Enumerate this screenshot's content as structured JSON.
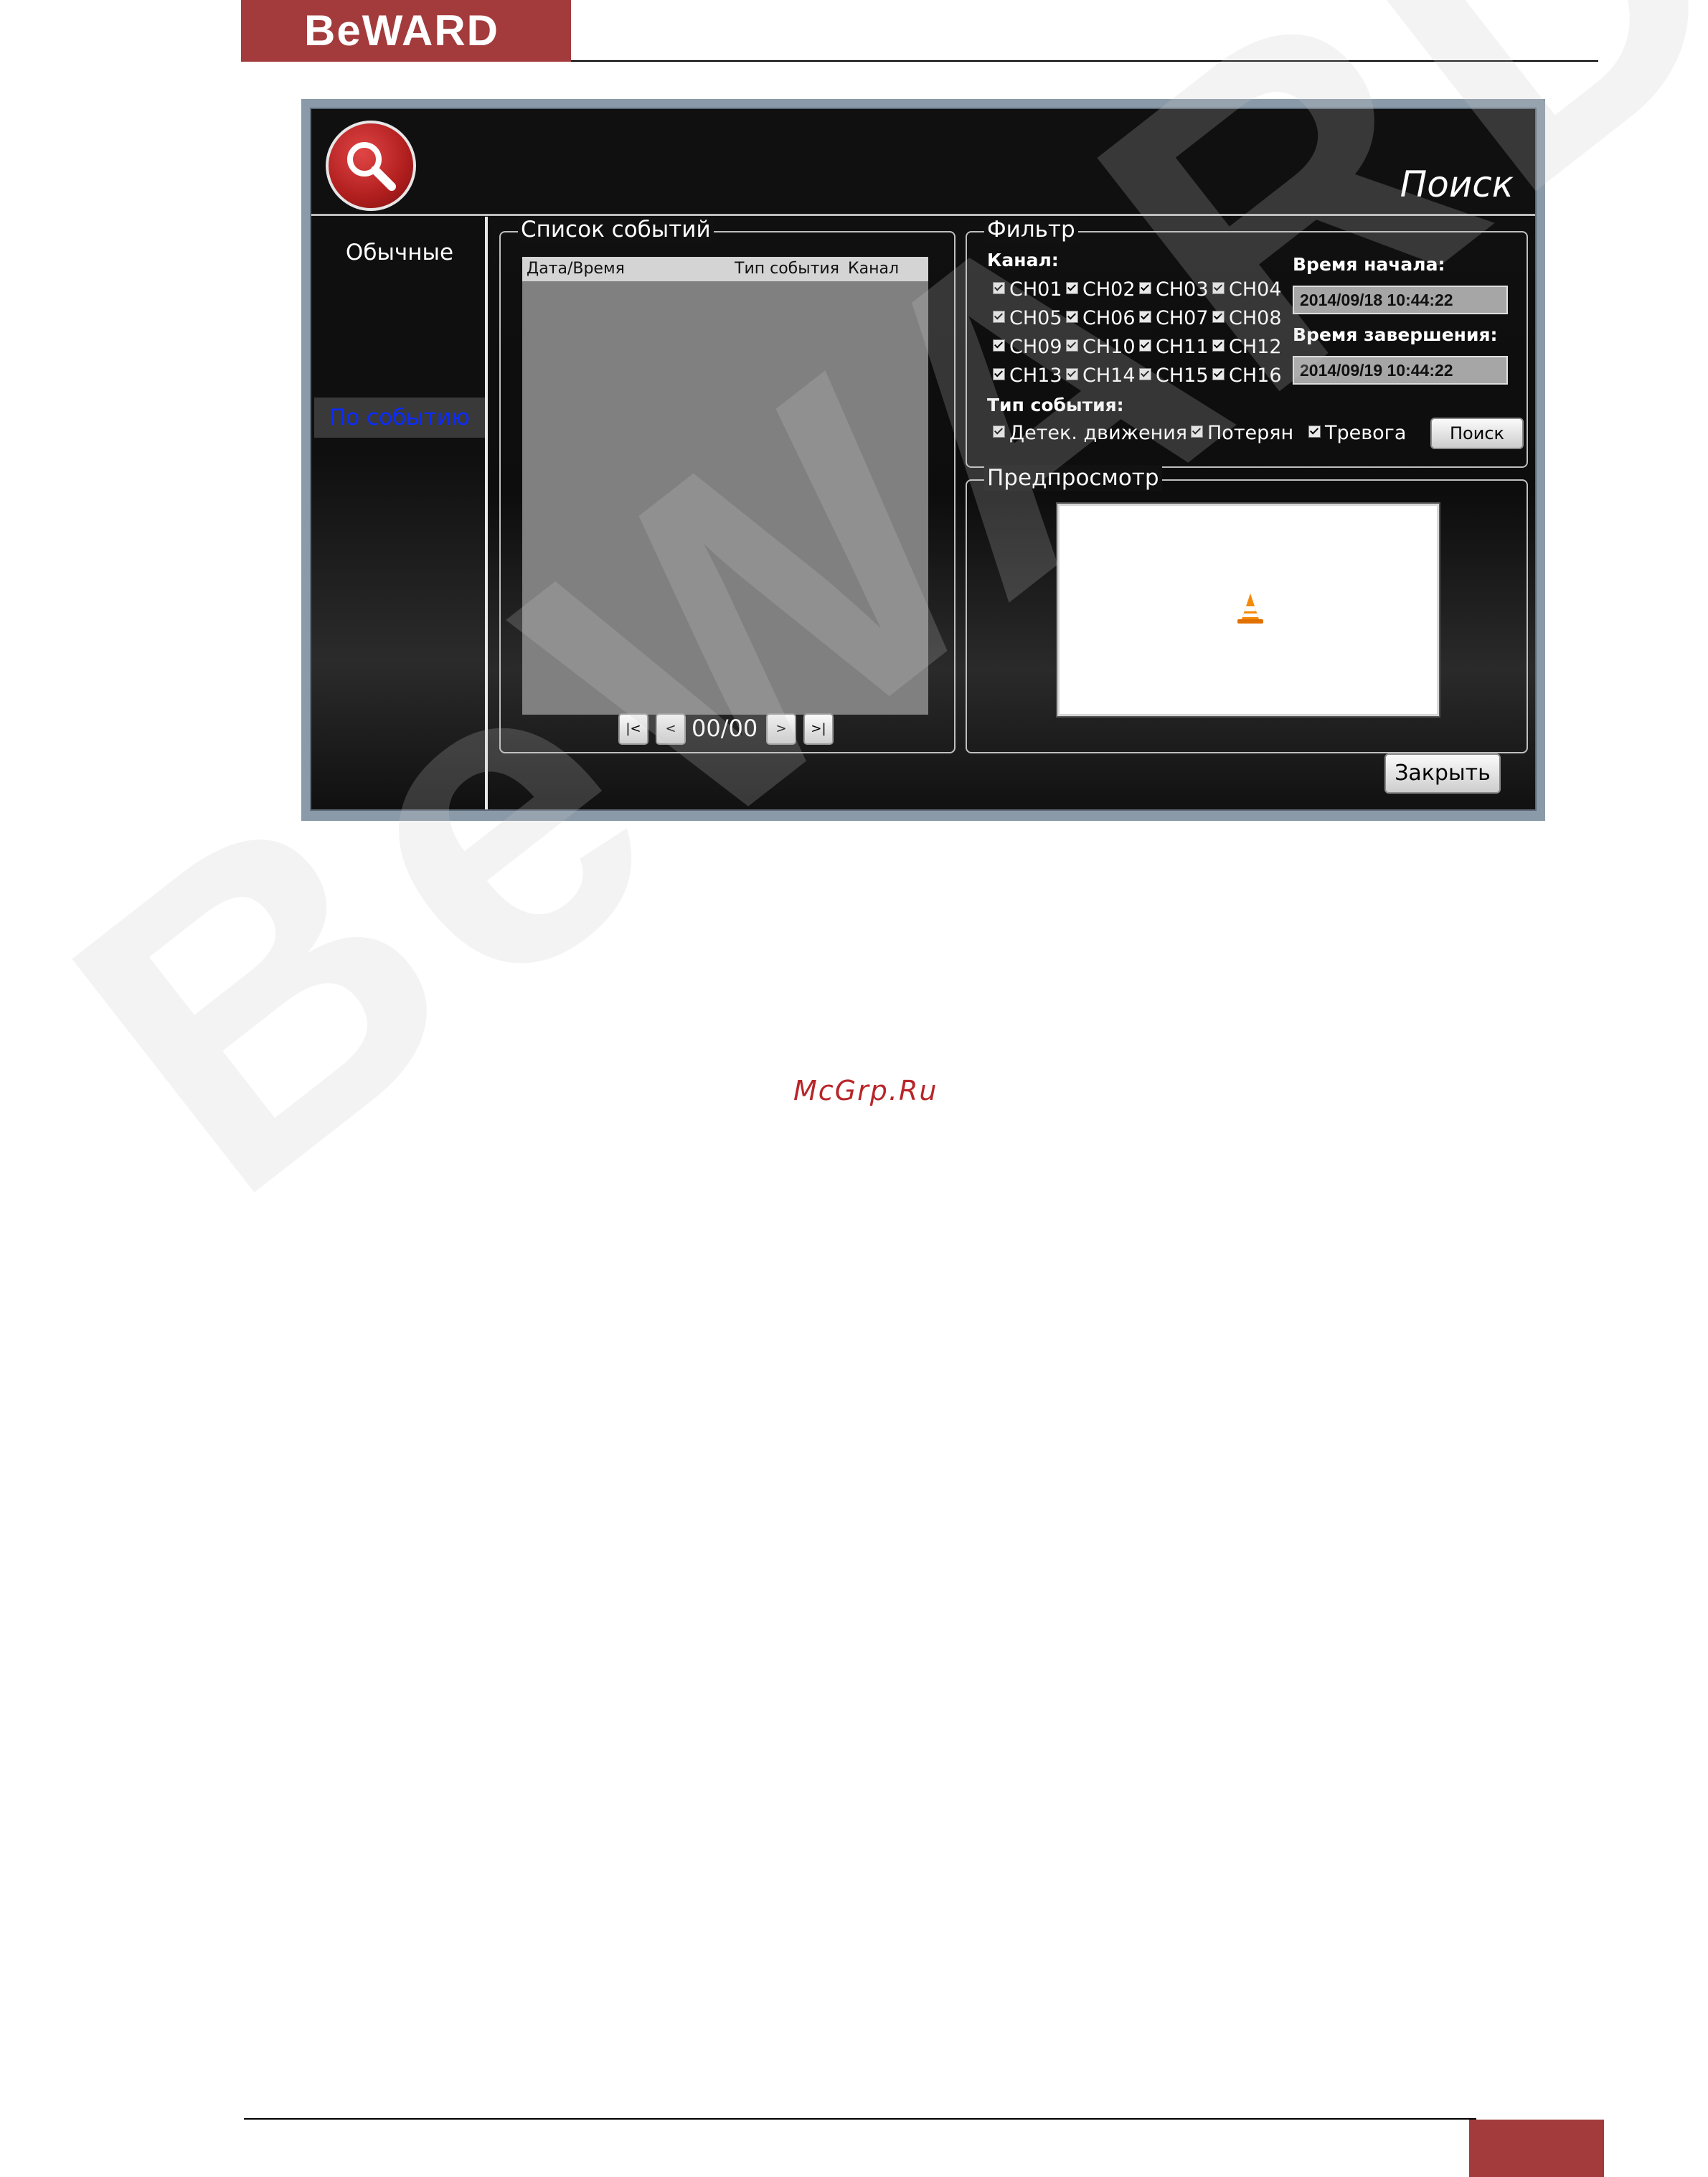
{
  "page": {
    "brand": "BeWARD",
    "watermark": "BeWARD",
    "site_mark": "McGrp.Ru"
  },
  "window": {
    "title": "Поиск",
    "nav": {
      "normal": "Обычные",
      "by_event": "По событию"
    },
    "events": {
      "title": "Список событий",
      "columns": [
        "Дата/Время",
        "Тип события",
        "Канал"
      ],
      "rows": [],
      "pager": {
        "first": "|<",
        "prev": "<",
        "count": "00/00",
        "next": ">",
        "last": ">|"
      }
    },
    "filter": {
      "title": "Фильтр",
      "channel_label": "Канал:",
      "channels": [
        "CH01",
        "CH02",
        "CH03",
        "CH04",
        "CH05",
        "CH06",
        "CH07",
        "CH08",
        "CH09",
        "CH10",
        "CH11",
        "CH12",
        "CH13",
        "CH14",
        "CH15",
        "CH16"
      ],
      "start_label": "Время начала:",
      "start_value": "2014/09/18 10:44:22",
      "end_label": "Время завершения:",
      "end_value": "2014/09/19 10:44:22",
      "event_type_label": "Тип события:",
      "event_types": [
        "Детек. движения",
        "Потерян",
        "Тревога"
      ],
      "search_button": "Поиск"
    },
    "preview": {
      "title": "Предпросмотр",
      "icon": "vlc-cone-icon"
    },
    "close_button": "Закрыть"
  }
}
